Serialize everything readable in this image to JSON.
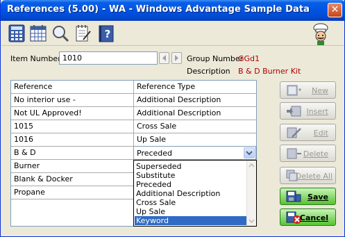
{
  "window": {
    "title": "References (5.00) - WA - Windows Advantage Sample Data",
    "close_glyph": "✕"
  },
  "toolbar": {
    "icons": [
      "calculator-icon",
      "calendar-icon",
      "magnifier-icon",
      "notepad-icon",
      "help-book-icon"
    ],
    "help_glyph": "?",
    "mascot": "chef-mascot-icon"
  },
  "form": {
    "item_number_label": "Item Number",
    "item_number_value": "1010",
    "group_number_label": "Group Number",
    "group_number_value": "GGd1",
    "description_label": "Description",
    "description_value": "B & D Burner Kit"
  },
  "grid": {
    "columns": [
      "Reference",
      "Reference Type"
    ],
    "rows": [
      [
        "No interior use -",
        "Additional Description"
      ],
      [
        "Not UL Approved!",
        "Additional Description"
      ],
      [
        "1015",
        "Cross Sale"
      ],
      [
        "1016",
        "Up Sale"
      ],
      [
        "B & D",
        ""
      ],
      [
        "Burner",
        ""
      ],
      [
        "Blank & Docker",
        ""
      ],
      [
        "Propane",
        ""
      ]
    ]
  },
  "dropdown": {
    "selected": "Preceded",
    "options": [
      "Superseded",
      "Substitute",
      "Preceded",
      "Additional Description",
      "Cross Sale",
      "Up Sale",
      "Keyword"
    ],
    "highlighted": "Keyword"
  },
  "actions": {
    "new": "New",
    "insert": "Insert",
    "edit": "Edit",
    "delete": "Delete",
    "delete_all": "Delete All",
    "save": "Save",
    "cancel": "Cancel"
  }
}
